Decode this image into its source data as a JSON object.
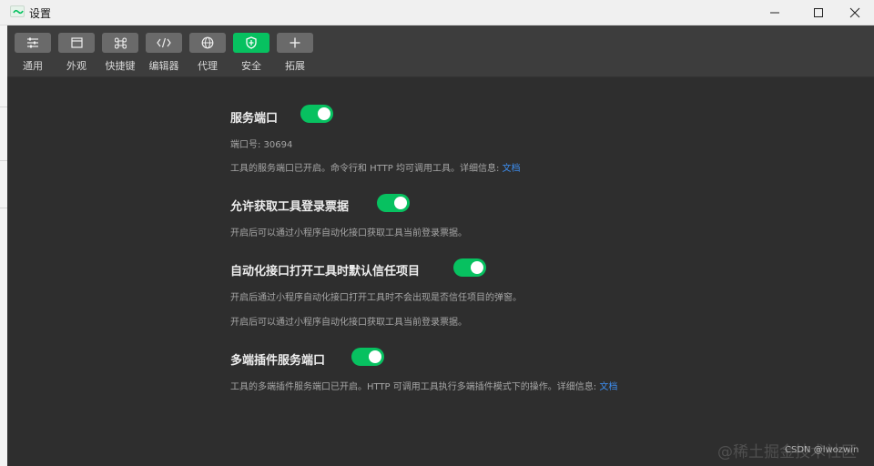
{
  "window": {
    "title": "设置"
  },
  "toolbar": {
    "items": [
      {
        "label": "通用",
        "icon": "sliders-icon"
      },
      {
        "label": "外观",
        "icon": "layout-icon"
      },
      {
        "label": "快捷键",
        "icon": "command-key-icon"
      },
      {
        "label": "编辑器",
        "icon": "code-icon"
      },
      {
        "label": "代理",
        "icon": "globe-icon"
      },
      {
        "label": "安全",
        "icon": "shield-icon",
        "active": true
      },
      {
        "label": "拓展",
        "icon": "plus-icon"
      }
    ]
  },
  "sections": {
    "service_port": {
      "title": "服务端口",
      "enabled": true,
      "port_line": "端口号: 30694",
      "desc_text": "工具的服务端口已开启。命令行和 HTTP 均可调用工具。详细信息: ",
      "link": "文档"
    },
    "login_ticket": {
      "title": "允许获取工具登录票据",
      "enabled": true,
      "desc": "开启后可以通过小程序自动化接口获取工具当前登录票据。"
    },
    "trust_project": {
      "title": "自动化接口打开工具时默认信任项目",
      "enabled": true,
      "desc1": "开启后通过小程序自动化接口打开工具时不会出现是否信任项目的弹窗。",
      "desc2": "开启后可以通过小程序自动化接口获取工具当前登录票据。"
    },
    "multi_port": {
      "title": "多端插件服务端口",
      "enabled": true,
      "desc_text": "工具的多端插件服务端口已开启。HTTP 可调用工具执行多端插件模式下的操作。详细信息: ",
      "link": "文档"
    }
  },
  "watermark": {
    "text": "@稀土掘金技术社区",
    "sub": "CSDN @lwozwin"
  },
  "colors": {
    "accent": "#07c160",
    "link": "#3d8ef0",
    "background": "#2e2e2e",
    "toolbar": "#3d3d3d"
  }
}
